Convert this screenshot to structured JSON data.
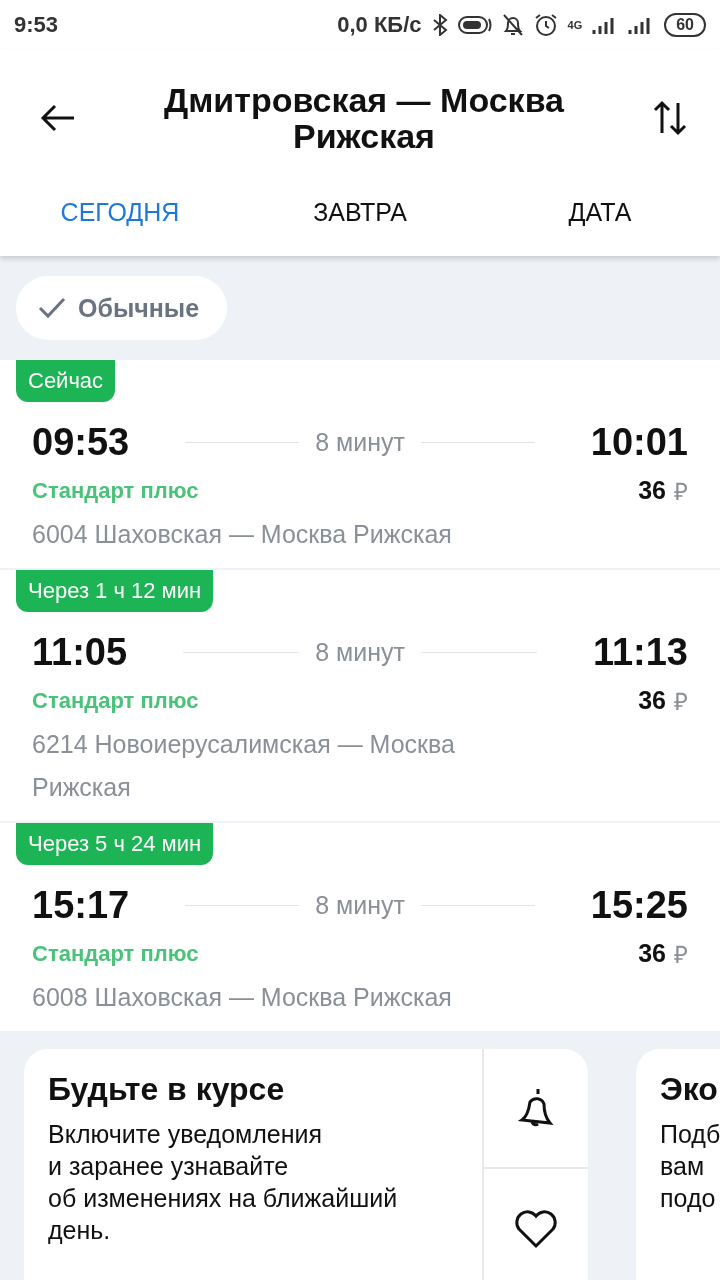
{
  "status_bar": {
    "time": "9:53",
    "speed": "0,0 КБ/с",
    "network": "4G",
    "battery": "60"
  },
  "header": {
    "title_lines": [
      "Дмитровская — Москва",
      "Рижская"
    ]
  },
  "tabs": [
    {
      "label": "СЕГОДНЯ",
      "selected": true
    },
    {
      "label": "ЗАВТРА",
      "selected": false
    },
    {
      "label": "ДАТА",
      "selected": false
    }
  ],
  "filter": {
    "label": "Обычные",
    "checked": true
  },
  "trains": [
    {
      "badge": "Сейчас",
      "depart": "09:53",
      "duration": "8 минут",
      "arrive": "10:01",
      "tariff": "Стандарт плюс",
      "price": "36",
      "currency": "₽",
      "route": "6004 Шаховская — Москва Рижская"
    },
    {
      "badge": "Через 1 ч 12 мин",
      "depart": "11:05",
      "duration": "8 минут",
      "arrive": "11:13",
      "tariff": "Стандарт плюс",
      "price": "36",
      "currency": "₽",
      "route": "6214 Новоиерусалимская — Москва Рижская"
    },
    {
      "badge": "Через 5 ч 24 мин",
      "depart": "15:17",
      "duration": "8 минут",
      "arrive": "15:25",
      "tariff": "Стандарт плюс",
      "price": "36",
      "currency": "₽",
      "route": "6008 Шаховская — Москва Рижская"
    }
  ],
  "cards": [
    {
      "title": "Будьте в курсе",
      "text_lines": [
        "Включите уведомления",
        "и заранее узнавайте",
        "об изменениях на ближайший",
        "день."
      ]
    },
    {
      "title": "Эко",
      "text_lines": [
        "Подб",
        "вам",
        "подо"
      ]
    }
  ]
}
